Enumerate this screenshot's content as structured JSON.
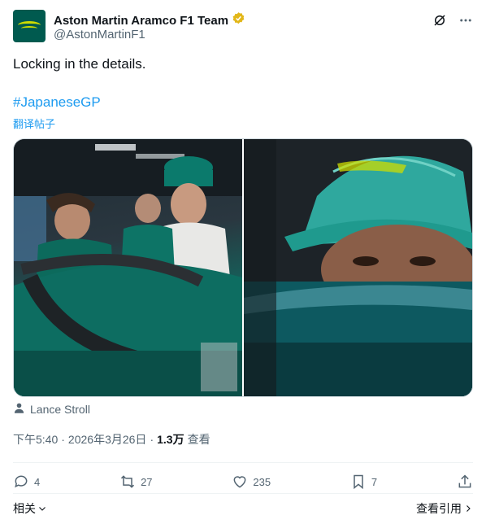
{
  "tweet": {
    "display_name": "Aston Martin Aramco F1 Team",
    "handle": "@AstonMartinF1",
    "text": "Locking in the details.",
    "hashtag": "#JapaneseGP",
    "translate_label": "翻译帖子",
    "tagged_user": "Lance Stroll",
    "time": "下午5:40",
    "separator": "·",
    "date": "2026年3月26日",
    "view_count": "1.3万",
    "view_label": "查看"
  },
  "actions": {
    "replies": "4",
    "reposts": "27",
    "likes": "235",
    "bookmarks": "7"
  },
  "footer": {
    "related": "相关",
    "quotes": "查看引用"
  },
  "colors": {
    "link": "#1d9bf0",
    "verified_badge": "#e2b719",
    "brand_green": "#005a4f"
  }
}
